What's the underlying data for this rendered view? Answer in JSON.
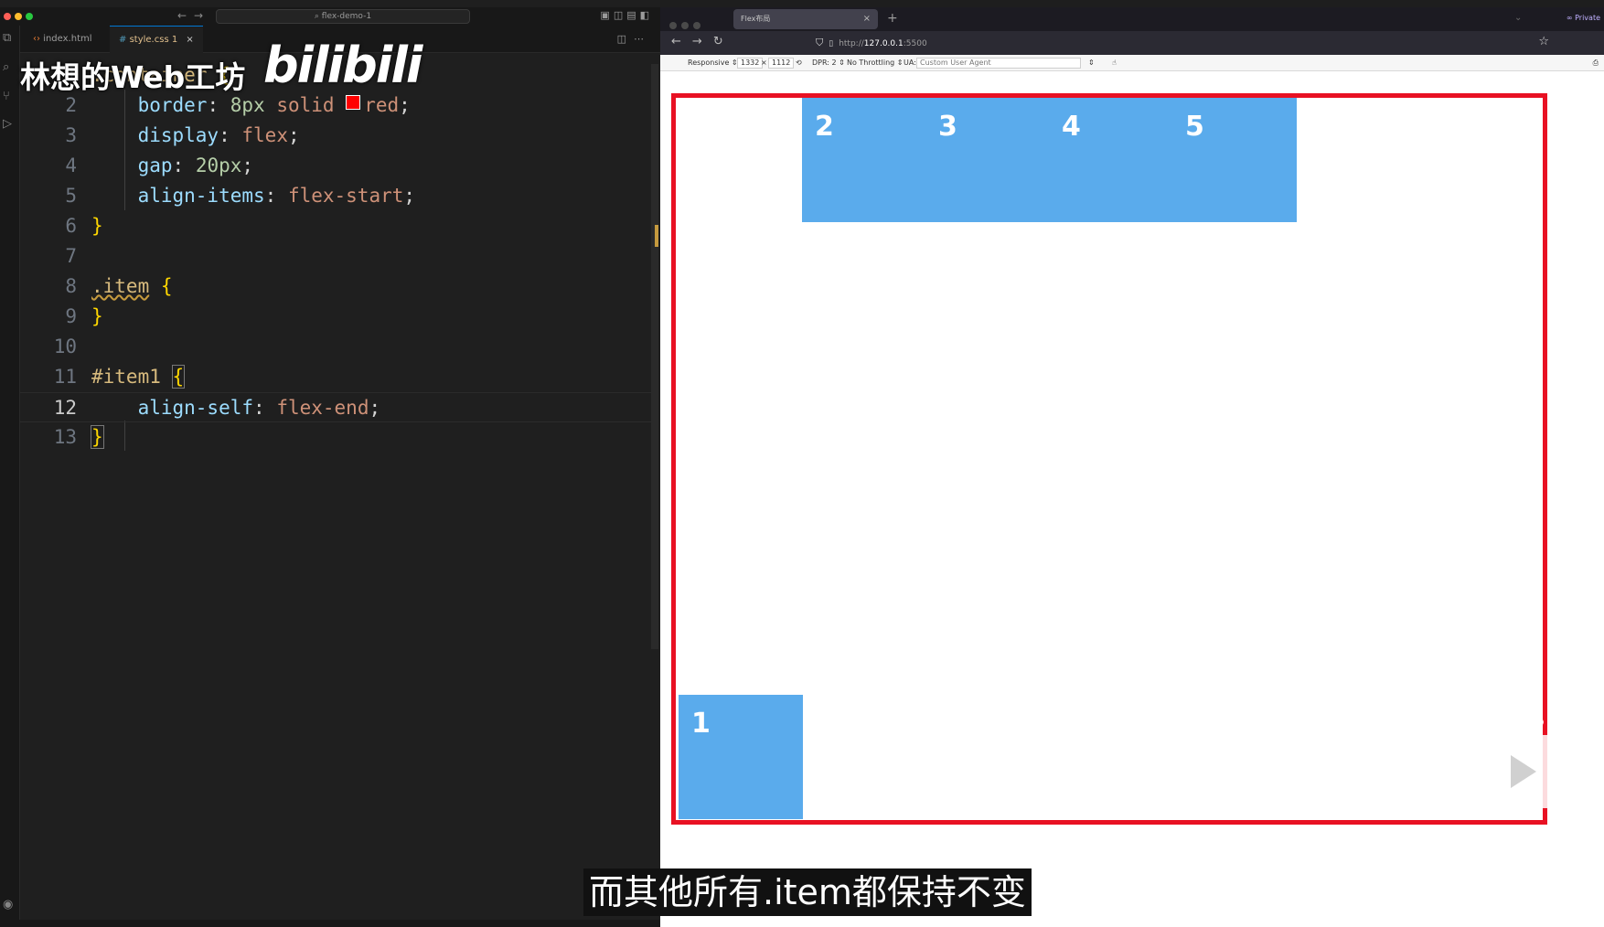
{
  "vscode": {
    "search_box": "flex-demo-1",
    "tabs": [
      {
        "label": "index.html",
        "icon": "code-icon"
      },
      {
        "label": "style.css 1",
        "icon": "hash-icon",
        "close": "×"
      }
    ],
    "code_lines": [
      {
        "n": "1",
        "text": ".container {"
      },
      {
        "n": "2",
        "text": "border: 8px solid red;"
      },
      {
        "n": "3",
        "text": "display: flex;"
      },
      {
        "n": "4",
        "text": "gap: 20px;"
      },
      {
        "n": "5",
        "text": "align-items: flex-start;"
      },
      {
        "n": "6",
        "text": "}"
      },
      {
        "n": "7",
        "text": ""
      },
      {
        "n": "8",
        "text": ".item {"
      },
      {
        "n": "9",
        "text": "}"
      },
      {
        "n": "10",
        "text": ""
      },
      {
        "n": "11",
        "text": "#item1 {"
      },
      {
        "n": "12",
        "text": "align-self: flex-end;"
      },
      {
        "n": "13",
        "text": "}"
      }
    ],
    "current_line": "12",
    "swatch_color": "#ff0000"
  },
  "watermark": {
    "text": "林想的Web工坊",
    "logo": "bilibili"
  },
  "browser": {
    "tab_title": "Flex布局",
    "tab_close": "×",
    "new_tab": "+",
    "private_label": "Private",
    "url_prefix": "http://",
    "url_host": "127.0.0.1",
    "url_port": ":5500",
    "responsive": {
      "mode": "Responsive ⇕",
      "width": "1332",
      "times": "×",
      "height": "1112",
      "dpr": "DPR: 2 ⇕",
      "throttling": "No Throttling ⇕",
      "ua_label": "UA:",
      "ua_value": "Custom User Agent"
    },
    "container_border_color": "#e81123",
    "item_color": "#5aabec",
    "items": [
      {
        "label": "1"
      },
      {
        "label": "2"
      },
      {
        "label": "3"
      },
      {
        "label": "4"
      },
      {
        "label": "5"
      }
    ]
  },
  "subtitle": "而其他所有.item都保持不变"
}
